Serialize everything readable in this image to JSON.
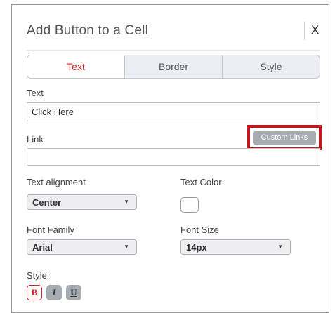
{
  "dialog": {
    "title": "Add Button to a Cell",
    "close_label": "X"
  },
  "tabs": [
    {
      "label": "Text",
      "active": true
    },
    {
      "label": "Border",
      "active": false
    },
    {
      "label": "Style",
      "active": false
    }
  ],
  "form": {
    "text_label": "Text",
    "text_value": "Click Here",
    "link_label": "Link",
    "link_value": "",
    "custom_links_label": "Custom Links",
    "text_alignment_label": "Text alignment",
    "text_alignment_value": "Center",
    "text_color_label": "Text Color",
    "text_color_value": "#ffffff",
    "font_family_label": "Font Family",
    "font_family_value": "Arial",
    "font_size_label": "Font Size",
    "font_size_value": "14px",
    "style_label": "Style",
    "style_buttons": {
      "bold": {
        "label": "B",
        "active": true
      },
      "italic": {
        "label": "I",
        "active": false
      },
      "underline": {
        "label": "U",
        "active": false
      }
    }
  },
  "colors": {
    "accent": "#d0272a",
    "highlight_box": "#c8161d",
    "button_gray": "#a7acb2"
  }
}
